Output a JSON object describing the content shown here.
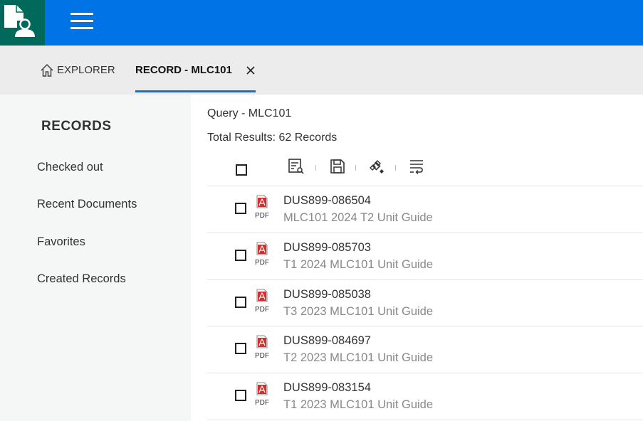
{
  "header": {
    "logo_icon": "document-user-icon",
    "menu_icon": "hamburger-menu-icon"
  },
  "tabs": [
    {
      "label": "EXPLORER",
      "icon": "home-icon"
    },
    {
      "label": "RECORD - MLC101",
      "icon": "close-icon",
      "active": true
    }
  ],
  "sidebar": {
    "title": "RECORDS",
    "items": [
      {
        "label": "Checked out"
      },
      {
        "label": "Recent Documents"
      },
      {
        "label": "Favorites"
      },
      {
        "label": "Created Records"
      }
    ]
  },
  "main": {
    "query": "Query - MLC101",
    "total": "Total Results: 62 Records",
    "toolbar": [
      "view-details-icon",
      "save-icon",
      "satellite-icon",
      "wrap-text-icon"
    ],
    "records": [
      {
        "id": "DUS899-086504",
        "title": "MLC101 2024 T2 Unit Guide",
        "type": "PDF"
      },
      {
        "id": "DUS899-085703",
        "title": "T1 2024 MLC101 Unit Guide",
        "type": "PDF"
      },
      {
        "id": "DUS899-085038",
        "title": "T3 2023 MLC101 Unit Guide",
        "type": "PDF"
      },
      {
        "id": "DUS899-084697",
        "title": "T2 2023 MLC101 Unit Guide",
        "type": "PDF"
      },
      {
        "id": "DUS899-083154",
        "title": "T1 2023 MLC101 Unit Guide",
        "type": "PDF"
      }
    ]
  },
  "colors": {
    "header_blue": "#0073e7",
    "logo_green": "#00695c",
    "pdf_red": "#d32f2f"
  }
}
